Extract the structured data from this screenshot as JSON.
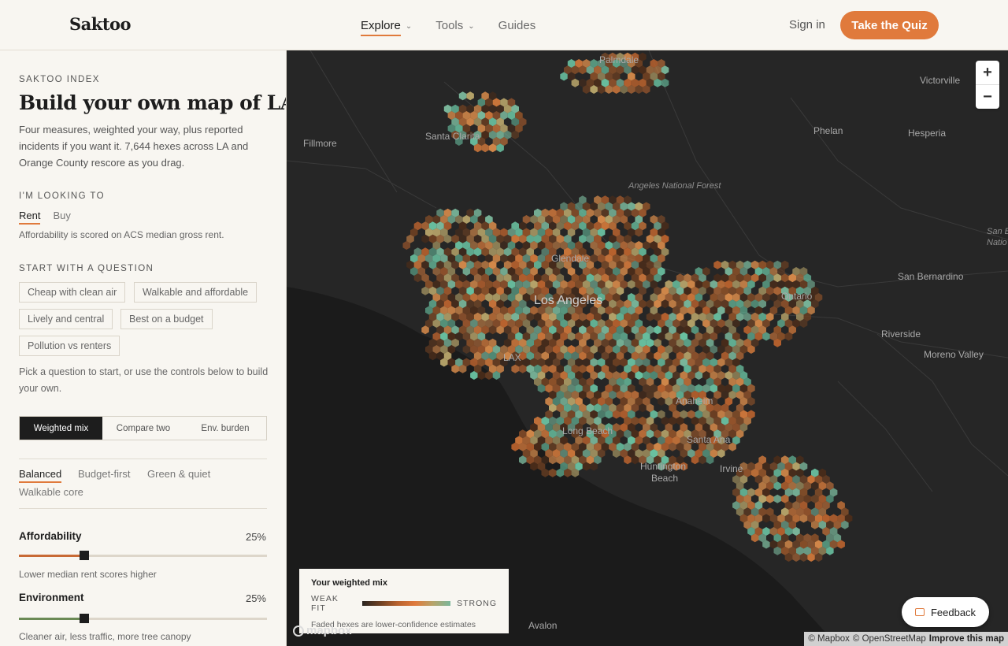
{
  "header": {
    "logo": "Saktoo",
    "nav": [
      {
        "label": "Explore",
        "dropdown": true,
        "active": true
      },
      {
        "label": "Tools",
        "dropdown": true,
        "active": false
      },
      {
        "label": "Guides",
        "dropdown": false,
        "active": false
      }
    ],
    "signin": "Sign in",
    "quiz": "Take the Quiz"
  },
  "sidebar": {
    "eyebrow": "SAKTOO INDEX",
    "title": "Build your own map of LA",
    "description": "Four measures, weighted your way, plus reported incidents if you want it. 7,644 hexes across LA and Orange County rescore as you drag.",
    "looking_label": "I'M LOOKING TO",
    "mode_tabs": [
      "Rent",
      "Buy"
    ],
    "mode_hint": "Affordability is scored on ACS median gross rent.",
    "question_label": "START WITH A QUESTION",
    "questions": [
      "Cheap with clean air",
      "Walkable and affordable",
      "Lively and central",
      "Best on a budget",
      "Pollution vs renters"
    ],
    "pick_hint": "Pick a question to start, or use the controls below to build your own.",
    "view_modes": [
      "Weighted mix",
      "Compare two",
      "Env. burden"
    ],
    "presets": [
      "Balanced",
      "Budget-first",
      "Green & quiet",
      "Walkable core"
    ],
    "sliders": [
      {
        "label": "Affordability",
        "value": 25,
        "value_text": "25%",
        "hint": "Lower median rent scores higher",
        "color": "#c86a35"
      },
      {
        "label": "Environment",
        "value": 25,
        "value_text": "25%",
        "hint": "Cleaner air, less traffic, more tree canopy",
        "color": "#6b8a55"
      }
    ]
  },
  "map": {
    "places": {
      "palmdale": "Palmdale",
      "victorville": "Victorville",
      "santa_clarita": "Santa Clarita",
      "fillmore": "Fillmore",
      "phelan": "Phelan",
      "hesperia": "Hesperia",
      "angeles_nf": "Angeles National Forest",
      "glendale": "Glendale",
      "los_angeles": "Los Angeles",
      "san_bernardino": "San Bernardino",
      "ontario": "Ontario",
      "riverside": "Riverside",
      "moreno_valley": "Moreno Valley",
      "lax": "LAX",
      "anaheim": "Anaheim",
      "long_beach": "Long Beach",
      "santa_ana": "Santa Ana",
      "huntington_beach_1": "Huntington",
      "huntington_beach_2": "Beach",
      "irvine": "Irvine",
      "avalon": "Avalon",
      "san_b_nf_1": "San B",
      "san_b_nf_2": "Natio"
    },
    "zoom_in": "+",
    "zoom_out": "−",
    "legend": {
      "title": "Your weighted mix",
      "weak": "WEAK FIT",
      "strong": "STRONG",
      "note": "Faded hexes are lower-confidence estimates"
    },
    "mapbox": "mapbox",
    "attribution": {
      "mapbox": "© Mapbox",
      "osm": "© OpenStreetMap",
      "improve": "Improve this map"
    },
    "feedback": "Feedback"
  },
  "colors": {
    "accent": "#e07a3c",
    "weak": "#2a2420",
    "strong": "#7ab79b"
  }
}
